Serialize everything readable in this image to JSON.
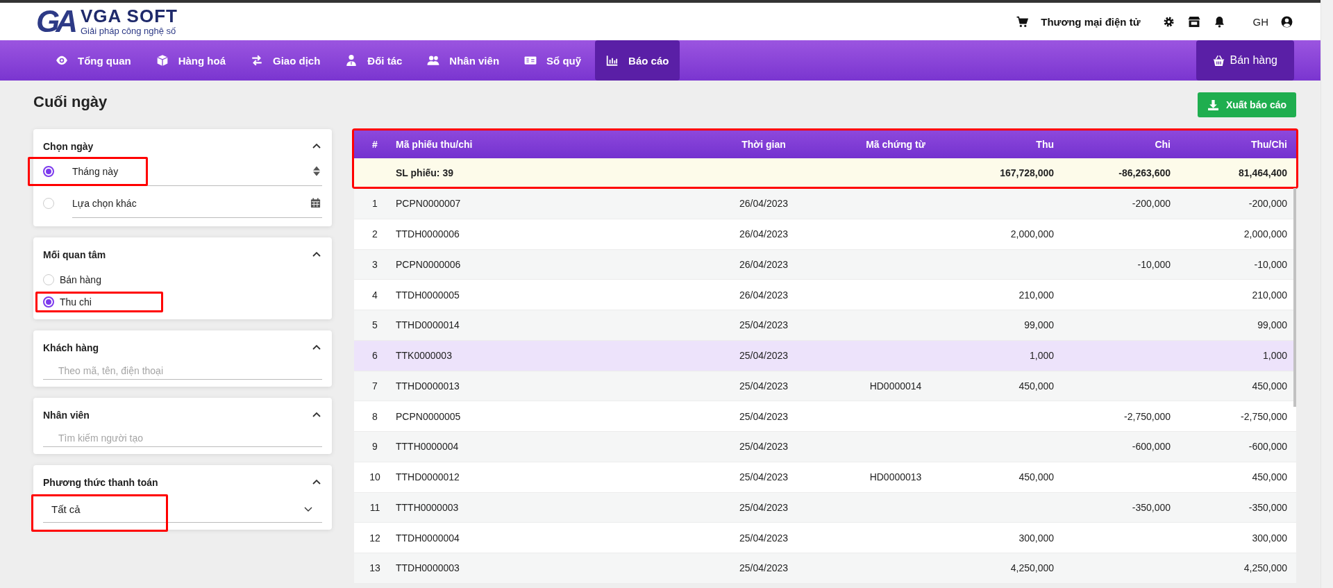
{
  "header": {
    "logo_mark": "GA",
    "brand": "VGA SOFT",
    "tagline": "Giải pháp công nghệ số",
    "shop_link": "Thương mại điện tử",
    "user_initials": "GH"
  },
  "nav": {
    "items": [
      {
        "label": "Tổng quan",
        "selected": false
      },
      {
        "label": "Hàng hoá",
        "selected": false
      },
      {
        "label": "Giao dịch",
        "selected": false
      },
      {
        "label": "Đối tác",
        "selected": false
      },
      {
        "label": "Nhân viên",
        "selected": false
      },
      {
        "label": "Sổ quỹ",
        "selected": false
      },
      {
        "label": "Báo cáo",
        "selected": true
      }
    ],
    "sale_button": "Bán hàng"
  },
  "page_title": "Cuối ngày",
  "export_button": "Xuất báo cáo",
  "filters": [
    {
      "kind": "radio-fields",
      "title": "Chọn ngày",
      "expanded": true,
      "options": [
        {
          "label": "Tháng này",
          "selected": true,
          "highlighted": true
        },
        {
          "label": "Lựa chọn khác",
          "selected": false,
          "highlighted": false
        }
      ]
    },
    {
      "kind": "radio-list",
      "title": "Mối quan tâm",
      "expanded": true,
      "options": [
        {
          "label": "Bán hàng",
          "selected": false,
          "highlighted": false
        },
        {
          "label": "Thu chi",
          "selected": true,
          "highlighted": true
        }
      ]
    },
    {
      "kind": "text-field",
      "title": "Khách hàng",
      "expanded": true,
      "placeholder": "Theo mã, tên, điện thoại"
    },
    {
      "kind": "text-field",
      "title": "Nhân viên",
      "expanded": true,
      "placeholder": "Tìm kiếm người tạo"
    },
    {
      "kind": "select",
      "title": "Phương thức thanh toán",
      "expanded": true,
      "value": "Tất cả",
      "highlighted": true
    }
  ],
  "table": {
    "highlighted": true,
    "columns": [
      "#",
      "Mã phiếu thu/chi",
      "Thời gian",
      "Mã chứng từ",
      "Thu",
      "Chi",
      "Thu/Chi"
    ],
    "summary": {
      "label": "SL phiếu: 39",
      "thu": "167,728,000",
      "chi": "-86,263,600",
      "net": "81,464,400"
    },
    "rows": [
      {
        "no": "1",
        "code": "PCPN0000007",
        "time": "26/04/2023",
        "chi": "-200,000",
        "net": "-200,000",
        "selected": false
      },
      {
        "no": "2",
        "code": "TTDH0000006",
        "time": "26/04/2023",
        "thu": "2,000,000",
        "net": "2,000,000",
        "selected": false
      },
      {
        "no": "3",
        "code": "PCPN0000006",
        "time": "26/04/2023",
        "chi": "-10,000",
        "net": "-10,000",
        "selected": false
      },
      {
        "no": "4",
        "code": "TTDH0000005",
        "time": "26/04/2023",
        "thu": "210,000",
        "net": "210,000",
        "selected": false
      },
      {
        "no": "5",
        "code": "TTHD0000014",
        "time": "25/04/2023",
        "thu": "99,000",
        "net": "99,000",
        "selected": false
      },
      {
        "no": "6",
        "code": "TTK0000003",
        "time": "25/04/2023",
        "thu": "1,000",
        "net": "1,000",
        "selected": true
      },
      {
        "no": "7",
        "code": "TTHD0000013",
        "time": "25/04/2023",
        "voucher": "HD0000014",
        "thu": "450,000",
        "net": "450,000",
        "selected": false
      },
      {
        "no": "8",
        "code": "PCPN0000005",
        "time": "25/04/2023",
        "chi": "-2,750,000",
        "net": "-2,750,000",
        "selected": false
      },
      {
        "no": "9",
        "code": "TTTH0000004",
        "time": "25/04/2023",
        "chi": "-600,000",
        "net": "-600,000",
        "selected": false
      },
      {
        "no": "10",
        "code": "TTHD0000012",
        "time": "25/04/2023",
        "voucher": "HD0000013",
        "thu": "450,000",
        "net": "450,000",
        "selected": false
      },
      {
        "no": "11",
        "code": "TTTH0000003",
        "time": "25/04/2023",
        "chi": "-350,000",
        "net": "-350,000",
        "selected": false
      },
      {
        "no": "12",
        "code": "TTDH0000004",
        "time": "25/04/2023",
        "thu": "300,000",
        "net": "300,000",
        "selected": false
      },
      {
        "no": "13",
        "code": "TTDH0000003",
        "time": "25/04/2023",
        "thu": "4,250,000",
        "net": "4,250,000",
        "selected": false
      }
    ]
  }
}
